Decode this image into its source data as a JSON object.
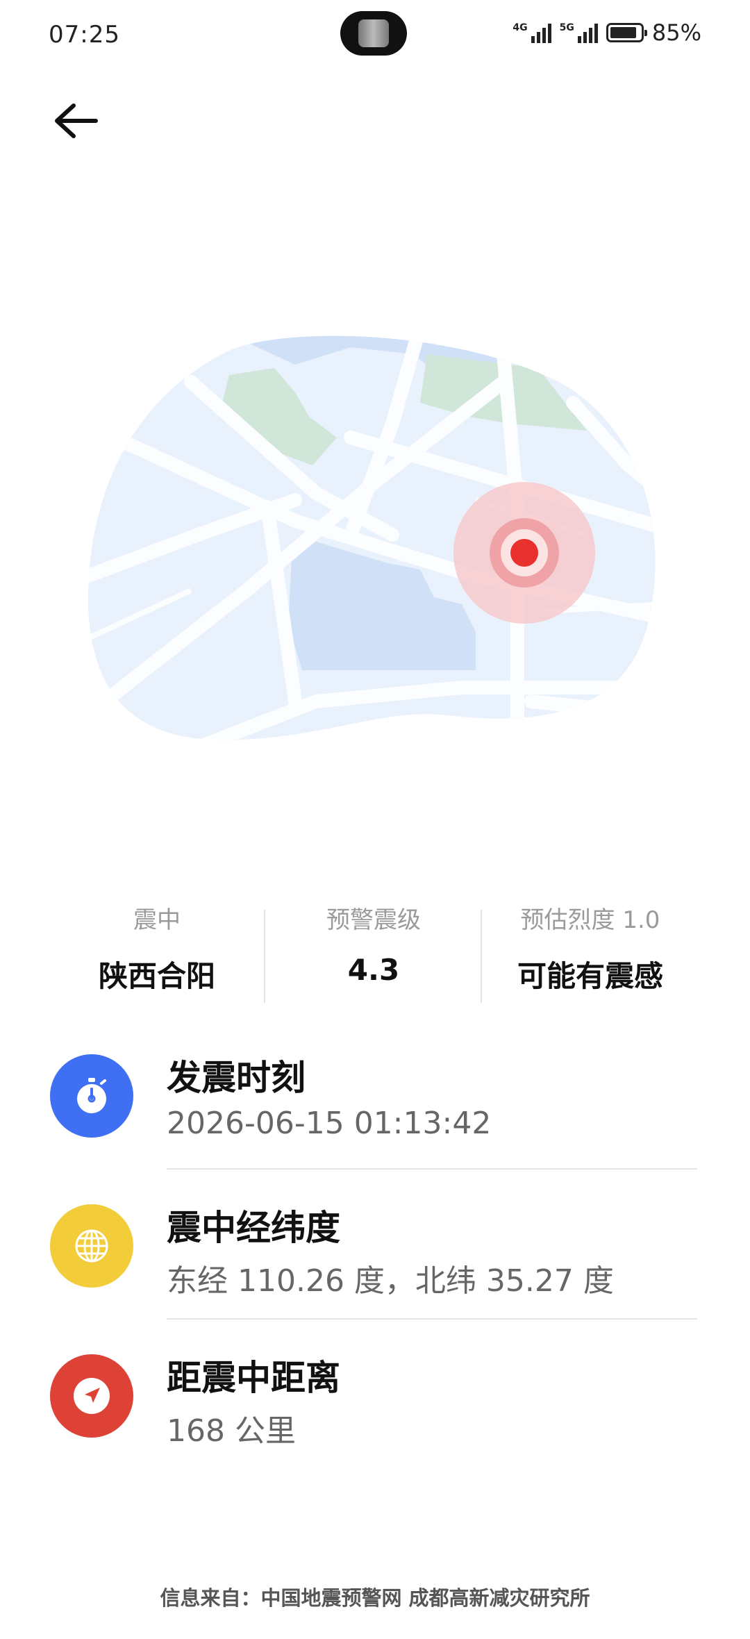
{
  "status_bar": {
    "time": "07:25",
    "network1": "4G",
    "network2": "5G",
    "battery_text": "85%"
  },
  "stats": [
    {
      "label": "震中",
      "value": "陕西合阳"
    },
    {
      "label": "预警震级",
      "value": "4.3"
    },
    {
      "label": "预估烈度 1.0",
      "value": "可能有震感"
    }
  ],
  "rows": [
    {
      "title": "发震时刻",
      "value": "2026-06-15 01:13:42",
      "icon": "stopwatch-icon",
      "color": "#3f6ff2"
    },
    {
      "title": "震中经纬度",
      "value": "东经 110.26 度，北纬 35.27 度",
      "icon": "globe-icon",
      "color": "#f3cc3a"
    },
    {
      "title": "距震中距离",
      "value": "168 公里",
      "icon": "navigation-arrow-icon",
      "color": "#de4237"
    }
  ],
  "footer": "信息来自：中国地震预警网 成都高新减灾研究所"
}
